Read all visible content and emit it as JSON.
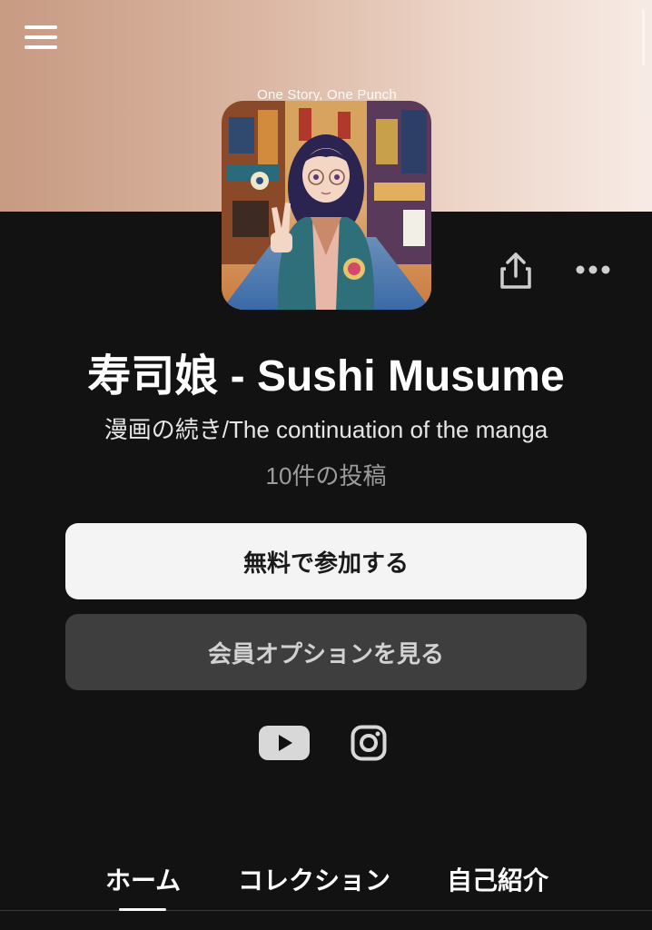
{
  "banner": {
    "colors": {
      "left": "#c79a82",
      "right": "#f7ebe5"
    }
  },
  "header": {
    "menu_icon": "hamburger-menu-icon"
  },
  "avatar": {
    "caption": "One Story, One Punch"
  },
  "actions": {
    "share_icon": "share-icon",
    "more_icon": "more-horizontal-icon"
  },
  "profile": {
    "title": "寿司娘 - Sushi Musume",
    "subtitle": "漫画の続き/The continuation of the manga",
    "post_count": "10件の投稿"
  },
  "buttons": {
    "join_label": "無料で参加する",
    "membership_label": "会員オプションを見る"
  },
  "social": {
    "youtube_icon": "youtube-icon",
    "instagram_icon": "instagram-icon"
  },
  "tabs": [
    {
      "label": "ホーム",
      "active": true
    },
    {
      "label": "コレクション",
      "active": false
    },
    {
      "label": "自己紹介",
      "active": false
    }
  ],
  "colors": {
    "background": "#121212",
    "primary_button": "#f4f4f4",
    "secondary_button": "#3e3e3e"
  }
}
